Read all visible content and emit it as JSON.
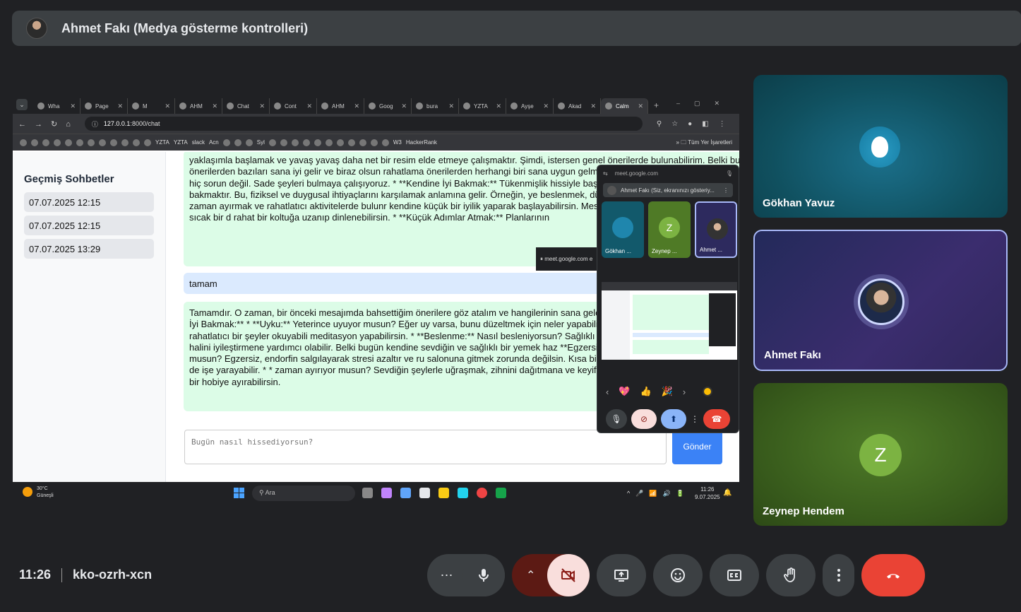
{
  "presenter_bar": {
    "title": "Ahmet Fakı (Medya gösterme kontrolleri)"
  },
  "browser": {
    "tabs": [
      {
        "label": "Wha"
      },
      {
        "label": "Page"
      },
      {
        "label": "M"
      },
      {
        "label": "AHM"
      },
      {
        "label": "Chat"
      },
      {
        "label": "Cont"
      },
      {
        "label": "AHM"
      },
      {
        "label": "Goog"
      },
      {
        "label": "bura"
      },
      {
        "label": "YZTA"
      },
      {
        "label": "Ayşe"
      },
      {
        "label": "Akad"
      },
      {
        "label": "Calm",
        "active": true
      }
    ],
    "url_host": "127.0.0.1",
    "url_path": ":8000/chat",
    "bookmarks": [
      "YZTA",
      "YZTA",
      "slack",
      "Acn",
      "Syl",
      "W3",
      "HackerRank"
    ],
    "bookmarks_folder": "Tüm Yer İşaretleri"
  },
  "app": {
    "sidebar_title": "Geçmiş Sohbetler",
    "history": [
      "07.07.2025 12:15",
      "07.07.2025 12:15",
      "07.07.2025 13:29"
    ],
    "messages": [
      {
        "role": "bot",
        "text": "yaklaşımla başlamak ve yavaş yavaş daha net bir resim elde etmeye çalışmaktır. Şimdi, istersen genel önerilerde bulunabilirim. Belki bu önerilerden bazıları sana iyi gelir ve biraz olsun rahatlama önerilerden herhangi biri sana uygun gelmezse veya denemek istemezsen, hiç sorun değil. Sade şeyleri bulmaya çalışıyoruz. * **Kendine İyi Bakmak:** Tükenmişlik hissiyle başa çıkmanın en öne kendine iyi bakmaktır. Bu, fiziksel ve duygusal ihtiyaçlarını karşılamak anlamına gelir. Örneğin, ye beslenmek, düzenli egzersiz yapmak, hobilerine zaman ayırmak ve rahatlatıcı aktivitelerde bulunr kendine küçük bir iyilik yaparak başlayabilirsin. Mesela, sevdiğin bir müzik dinleyebilir, sıcak bir d rahat bir koltuğa uzanıp dinlenebilirsin. * **Küçük Adımlar Atmak:** Planlarının"
      },
      {
        "role": "user",
        "text": "tamam"
      },
      {
        "role": "bot",
        "text": "Tamamdır. O zaman, bir önceki mesajımda bahsettiğim önerilere göz atalım ve hangilerinin sana gelebileceğini düşünelim. * **Kendine İyi Bakmak:** * **Uyku:** Yeterince uyuyor musun? Eğer uy varsa, bunu düzeltmek için neler yapabilirsin? Belki yatmadan önce rahatlatıcı bir şeyler okuyabili meditasyon yapabilirsin. * **Beslenme:** Nasıl besleniyorsun? Sağlıklı ve dengeli beslenmek, ene ve ruh halini iyileştirmene yardımcı olabilir. Belki bugün kendine sevdiğin ve sağlıklı bir yemek haz **Egzersiz:** Düzenli egzersiz yapıyor musun? Egzersiz, endorfin salgılayarak stresi azaltır ve ru salonuna gitmek zorunda değilsin. Kısa bir yürüyüş, yoga veya dans etmek de işe yarayabilir. * * zaman ayırıyor musun? Sevdiğin şeylerle uğraşmak, zihnini dağıtmana ve keyif almana yardımcı saatini sevdiğin bir hobiye ayırabilirsin."
      }
    ],
    "input_placeholder": "Bugün nasıl hissediyorsun?",
    "send_label": "Gönder"
  },
  "snackbar": {
    "text": "meet.google.com e"
  },
  "taskbar": {
    "temp": "30°C",
    "weather": "Güneşli",
    "search": "Ara",
    "time": "11:26",
    "date": "9.07.2025"
  },
  "mini_meet": {
    "url": "meet.google.com",
    "presenting": "Ahmet Fakı (Siz, ekranınızı gösteriy...",
    "tiles": [
      {
        "name": "Gökhan ...",
        "avatar": "owl"
      },
      {
        "name": "Zeynep ...",
        "avatar": "Z"
      },
      {
        "name": "Ahmet ...",
        "avatar": "photo"
      }
    ],
    "reactions": [
      "💖",
      "👍",
      "🎉"
    ]
  },
  "participants": [
    {
      "name": "Gökhan Yavuz",
      "avatar": "owl"
    },
    {
      "name": "Ahmet Fakı",
      "avatar": "photo"
    },
    {
      "name": "Zeynep Hendem",
      "avatar": "Z"
    }
  ],
  "meeting": {
    "time": "11:26",
    "code": "kko-ozrh-xcn"
  },
  "colors": {
    "end_call": "#ea4335",
    "cam_off": "#f9dedc",
    "accent": "#8ab4f8"
  }
}
